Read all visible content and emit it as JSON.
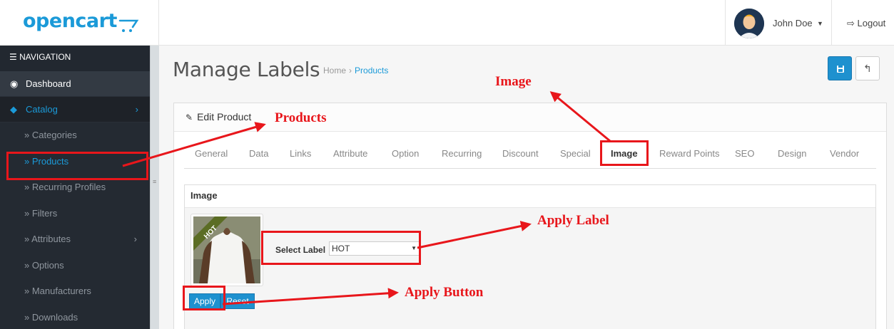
{
  "header": {
    "logo_text": "opencart",
    "user_name": "John Doe",
    "logout_label": "Logout"
  },
  "sidebar": {
    "heading": "NAVIGATION",
    "dashboard": "Dashboard",
    "catalog": "Catalog",
    "items": [
      {
        "label": "Categories"
      },
      {
        "label": "Products"
      },
      {
        "label": "Recurring Profiles"
      },
      {
        "label": "Filters"
      },
      {
        "label": "Attributes"
      },
      {
        "label": "Options"
      },
      {
        "label": "Manufacturers"
      },
      {
        "label": "Downloads"
      }
    ]
  },
  "page": {
    "title": "Manage Labels",
    "breadcrumb_home": "Home",
    "breadcrumb_current": "Products"
  },
  "panel": {
    "heading": "Edit Product"
  },
  "tabs": [
    {
      "label": "General"
    },
    {
      "label": "Data"
    },
    {
      "label": "Links"
    },
    {
      "label": "Attribute"
    },
    {
      "label": "Option"
    },
    {
      "label": "Recurring"
    },
    {
      "label": "Discount"
    },
    {
      "label": "Special"
    },
    {
      "label": "Image"
    },
    {
      "label": "Reward Points"
    },
    {
      "label": "SEO"
    },
    {
      "label": "Design"
    },
    {
      "label": "Vendor"
    }
  ],
  "image_section": {
    "heading": "Image",
    "badge_text": "HOT",
    "select_label": "Select Label",
    "select_value": "HOT",
    "apply_label": "Apply",
    "reset_label": "Reset"
  },
  "annotations": {
    "image": "Image",
    "products": "Products",
    "apply_label": "Apply Label",
    "apply_button": "Apply Button"
  },
  "colors": {
    "accent": "#1b9ad8",
    "annotation": "#e8161b",
    "sidebar_bg": "#2a3038"
  }
}
